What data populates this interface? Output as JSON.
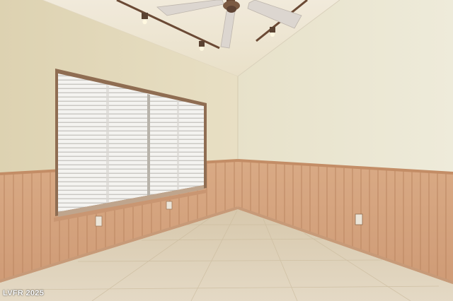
{
  "watermark": {
    "text": "LVFR 2025"
  },
  "colors": {
    "wall_left": "#e6dcbf",
    "wall_right": "#ebe5cf",
    "ceiling": "#efe7d3",
    "wainscot": "#d5a480",
    "wainscot_line": "#b9845f",
    "chair_rail": "#c99672",
    "floor": "#dccfb6",
    "blinds": "#f2f1ee",
    "window_frame": "#a98566",
    "fan": "#dcd6d0",
    "track": "#6b4a35"
  },
  "icons": [
    "ceiling-fan-icon",
    "track-light-icon",
    "window-blinds-icon",
    "electrical-outlet-icon"
  ]
}
